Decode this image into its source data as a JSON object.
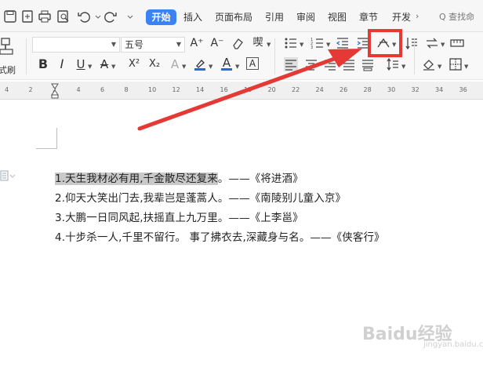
{
  "tabs": {
    "items": [
      {
        "label": "开始",
        "active": true
      },
      {
        "label": "插入"
      },
      {
        "label": "页面布局"
      },
      {
        "label": "引用"
      },
      {
        "label": "审阅"
      },
      {
        "label": "视图"
      },
      {
        "label": "章节"
      },
      {
        "label": "开发"
      }
    ],
    "more": "›",
    "search": "Q 查找命"
  },
  "ribbon": {
    "paste_label": "式刷",
    "font_size": "五号",
    "bold": "B",
    "italic": "I",
    "underline": "U",
    "strike": "A",
    "superscript": "X²",
    "subscript": "X₂",
    "font_color": "A",
    "char_border": "A",
    "grow_font": "A⁺",
    "shrink_font": "A⁻",
    "phonetic": "喫"
  },
  "ruler": {
    "ticks": [
      "4",
      "2",
      "2",
      "4",
      "6",
      "8",
      "10",
      "12",
      "14",
      "16",
      "18",
      "20",
      "22",
      "24",
      "26",
      "28",
      "30",
      "32",
      "34",
      "36"
    ]
  },
  "document": {
    "lines": [
      {
        "selected_text": "1.天生我材必有用,千金散尽还复来",
        "rest": "。——《将进酒》"
      },
      {
        "selected_text": "",
        "rest": "2.仰天大笑出门去,我辈岂是蓬蒿人。——《南陵别儿童入京》"
      },
      {
        "selected_text": "",
        "rest": "3.大鹏一日同风起,扶摇直上九万里。——《上李邕》"
      },
      {
        "selected_text": "",
        "rest": "4.十步杀一人,千里不留行。 事了拂衣去,深藏身与名。——《侠客行》"
      }
    ]
  },
  "watermark": {
    "text": "Baidu经验",
    "sub": "jingyan.baidu.com"
  },
  "colors": {
    "accent": "#3b82f6",
    "highlight_box": "#e53935",
    "arrow": "#e53935",
    "selection": "#c9c9c9"
  }
}
